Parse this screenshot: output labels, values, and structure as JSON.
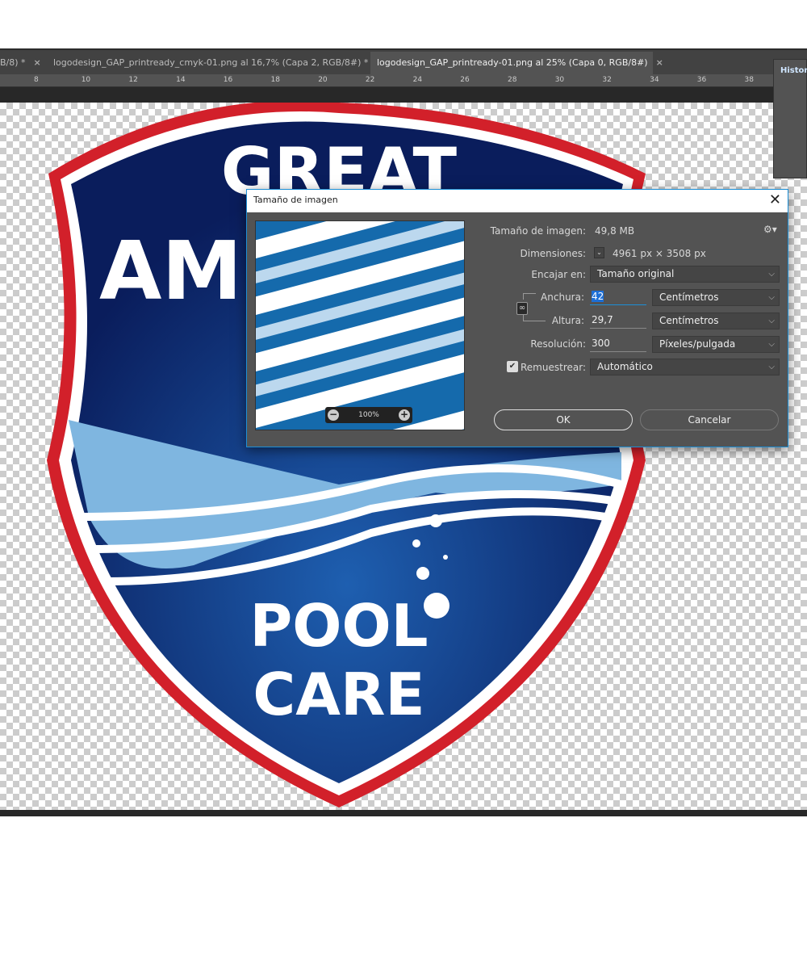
{
  "tabs": [
    {
      "label": "B/8) *",
      "close": "×"
    },
    {
      "label": "logodesign_GAP_printready_cmyk-01.png al 16,7% (Capa 2, RGB/8#) *",
      "close": "×"
    },
    {
      "label": "logodesign_GAP_printready-01.png al 25% (Capa 0, RGB/8#)",
      "close": "×"
    }
  ],
  "ruler": [
    "8",
    "10",
    "12",
    "14",
    "16",
    "18",
    "20",
    "22",
    "24",
    "26",
    "28",
    "30",
    "32",
    "34",
    "36",
    "38"
  ],
  "history_panel": {
    "title": "Historia"
  },
  "logo": {
    "line1": "GREAT",
    "line2": "AMERICAN",
    "line3": "POOL",
    "line4": "CARE"
  },
  "dialog": {
    "title": "Tamaño de imagen",
    "close": "✕",
    "image_size_label": "Tamaño de imagen:",
    "image_size_value": "49,8 MB",
    "dimensions_label": "Dimensiones:",
    "dimensions_value": "4961 px × 3508 px",
    "fit_label": "Encajar en:",
    "fit_value": "Tamaño original",
    "width_label": "Anchura:",
    "width_value": "42",
    "width_unit": "Centímetros",
    "height_label": "Altura:",
    "height_value": "29,7",
    "height_unit": "Centímetros",
    "resolution_label": "Resolución:",
    "resolution_value": "300",
    "resolution_unit": "Píxeles/pulgada",
    "resample_label": "Remuestrear:",
    "resample_checked": true,
    "resample_value": "Automático",
    "preview_zoom": "100%",
    "ok": "OK",
    "cancel": "Cancelar"
  }
}
